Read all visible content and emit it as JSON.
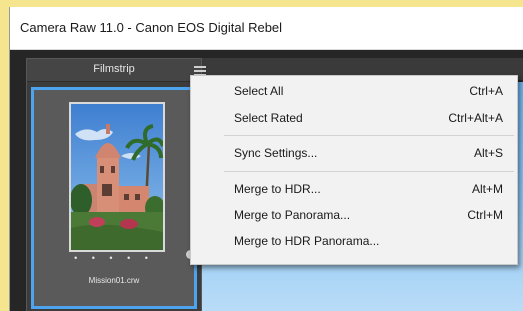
{
  "window": {
    "title": "Camera Raw 11.0  -  Canon EOS Digital Rebel"
  },
  "filmstrip": {
    "header_label": "Filmstrip",
    "menu_icon": "hamburger-menu-icon",
    "items": [
      {
        "filename": "Mission01.crw",
        "rating_dots": "• • • • •",
        "selected": true
      }
    ]
  },
  "context_menu": {
    "items": [
      {
        "label": "Select All",
        "shortcut": "Ctrl+A"
      },
      {
        "label": "Select Rated",
        "shortcut": "Ctrl+Alt+A"
      },
      {
        "label": "Sync Settings...",
        "shortcut": "Alt+S"
      },
      {
        "label": "Merge to HDR...",
        "shortcut": "Alt+M"
      },
      {
        "label": "Merge to Panorama...",
        "shortcut": "Ctrl+M"
      },
      {
        "label": "Merge to HDR Panorama...",
        "shortcut": ""
      }
    ]
  },
  "colors": {
    "selection": "#4ea3ee",
    "background": "#f6e58f",
    "panel": "#3c3c3c"
  }
}
